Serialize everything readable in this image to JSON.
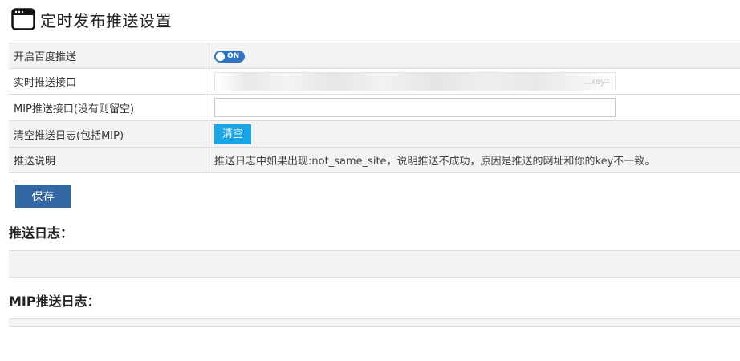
{
  "header": {
    "title": "定时发布推送设置",
    "icon": "window-icon"
  },
  "settings": {
    "rows": [
      {
        "label": "开启百度推送",
        "toggle_text": "ON",
        "toggle_color": "#2f74c2"
      },
      {
        "label": "实时推送接口",
        "value": "...key="
      },
      {
        "label": "MIP推送接口(没有则留空)",
        "value": ""
      },
      {
        "label": "清空推送日志(包括MIP)",
        "button": "清空",
        "button_color": "#1aa6e6"
      },
      {
        "label": "推送说明",
        "text": "推送日志中如果出现:not_same_site，说明推送不成功，原因是推送的网址和你的key不一致。"
      }
    ]
  },
  "save_button": {
    "label": "保存",
    "color": "#3367a3"
  },
  "push_log": {
    "title": "推送日志："
  },
  "mip_push_log": {
    "title": "MIP推送日志："
  }
}
